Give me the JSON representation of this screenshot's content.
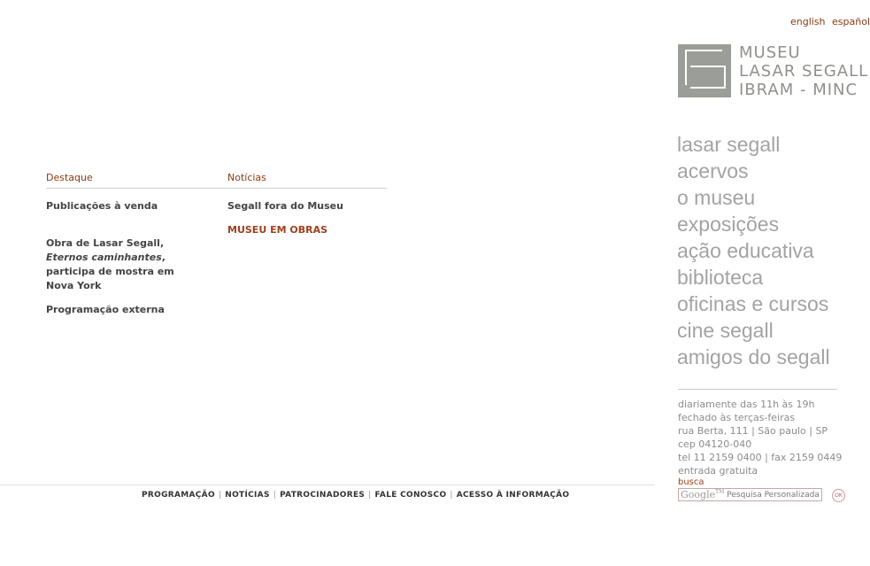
{
  "languages": [
    "english",
    "español"
  ],
  "logo": {
    "line1": "MUSEU",
    "line2": "LASAR SEGALL",
    "line3": "IBRAM - MINC"
  },
  "main_nav": [
    "lasar segall",
    "acervos",
    "o museu",
    "exposições",
    "ação educativa",
    "biblioteca",
    "oficinas e cursos",
    "cine segall",
    "amigos do segall"
  ],
  "info": [
    "diariamente das 11h às 19h",
    "fechado às terças-feiras",
    "rua Berta, 111 | São paulo | SP",
    "cep 04120-040",
    "tel 11 2159 0400 | fax 2159 0449",
    "entrada gratuita"
  ],
  "search": {
    "label": "busca",
    "google": "Google",
    "tm": "TM",
    "placeholder": "Pesquisa Personalizada",
    "button": "OK"
  },
  "destaque": {
    "heading": "Destaque",
    "item1": "Publicações à venda",
    "item2_pre": "Obra de Lasar Segall,",
    "item2_italic": "Eternos caminhantes",
    "item2_post": ", participa de mostra em Nova York",
    "item3": "Programação externa"
  },
  "noticias": {
    "heading": "Notícias",
    "item1": "Segall fora do Museu",
    "item2": "MUSEU EM OBRAS"
  },
  "footer": [
    "PROGRAMAÇÃO",
    "NOTÍCIAS",
    "PATROCINADORES",
    "FALE CONOSCO",
    "ACESSO À INFORMAÇÃO"
  ],
  "colors": {
    "accent": "#8a3a10",
    "nav_gray": "#a3a3a3",
    "logo_gray": "#9b9e98"
  }
}
